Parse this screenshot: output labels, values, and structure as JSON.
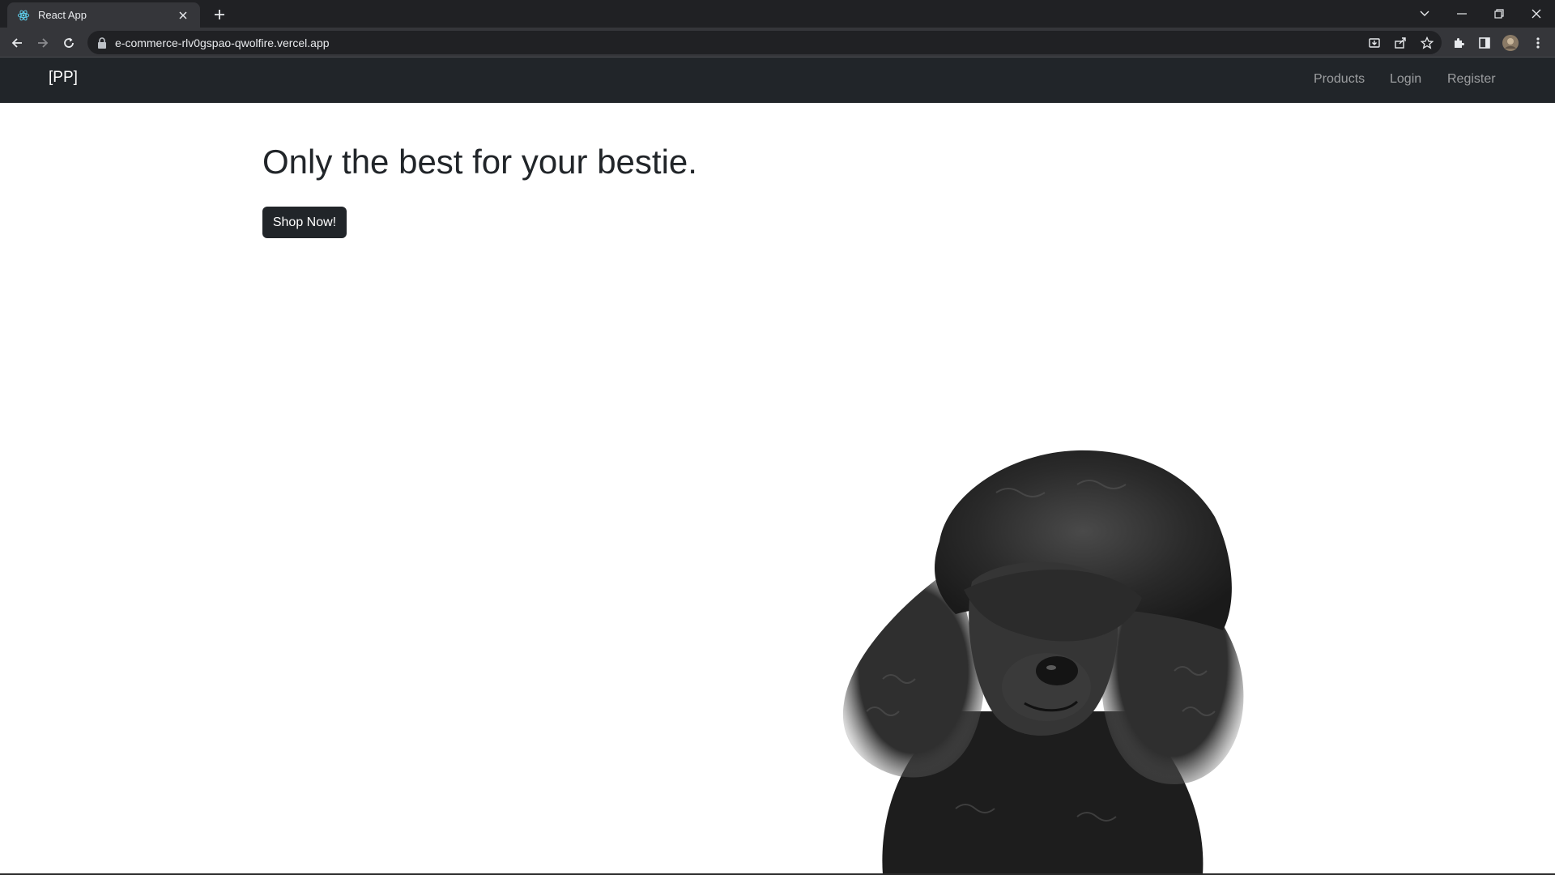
{
  "browser": {
    "tab_title": "React App",
    "url": "e-commerce-rlv0gspao-qwolfire.vercel.app",
    "favicon_icon": "react-icon",
    "accent": "#61dafb"
  },
  "navbar": {
    "brand": "[PP]",
    "links": [
      "Products",
      "Login",
      "Register"
    ],
    "background": "#212529"
  },
  "hero": {
    "title": "Only the best for your bestie.",
    "button_label": "Shop Now!",
    "image": "black-poodle-photo"
  }
}
